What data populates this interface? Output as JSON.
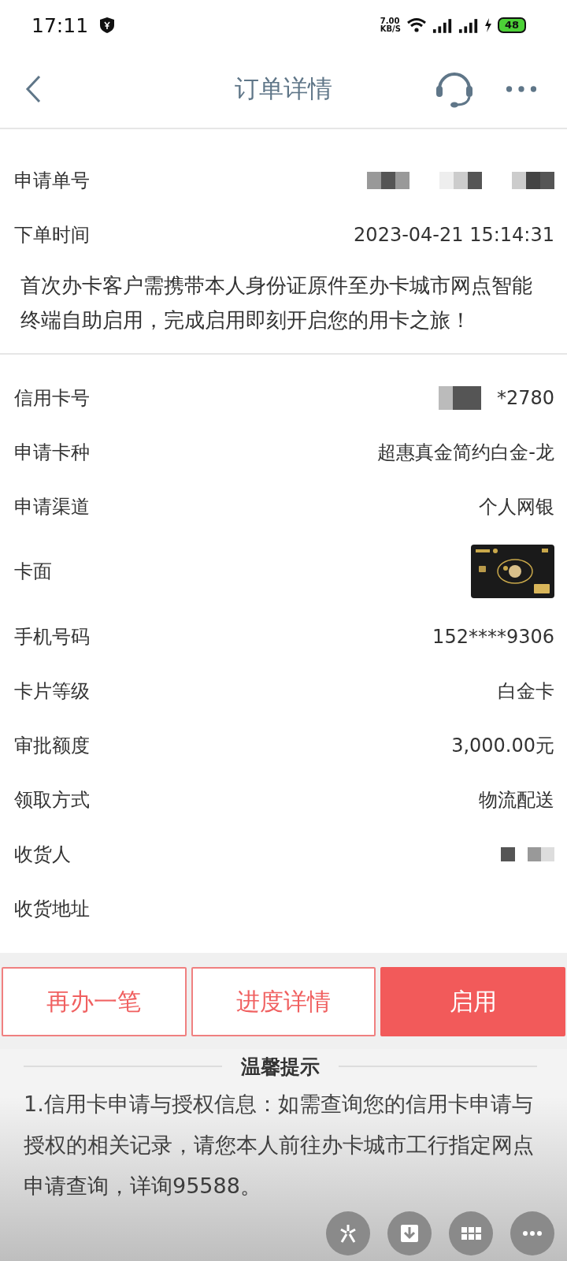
{
  "status_bar": {
    "time": "17:11",
    "speed": "7.00",
    "speed_unit": "KB/S",
    "battery": "48"
  },
  "header": {
    "title": "订单详情"
  },
  "top_rows": [
    {
      "label": "申请单号",
      "kind": "masked"
    },
    {
      "label": "下单时间",
      "kind": "text",
      "value": "2023-04-21 15:14:31"
    }
  ],
  "notice": "首次办卡客户需携带本人身份证原件至办卡城市网点智能终端自助启用，完成启用即刻开启您的用卡之旅！",
  "rows": [
    {
      "label": "信用卡号",
      "kind": "masked_text",
      "value": "*2780"
    },
    {
      "label": "申请卡种",
      "kind": "text",
      "value": "超惠真金简约白金-龙"
    },
    {
      "label": "申请渠道",
      "kind": "text",
      "value": "个人网银"
    },
    {
      "label": "卡面",
      "kind": "card"
    },
    {
      "label": "手机号码",
      "kind": "text",
      "value": "152****9306"
    },
    {
      "label": "卡片等级",
      "kind": "text",
      "value": "白金卡"
    },
    {
      "label": "审批额度",
      "kind": "text",
      "value": "3,000.00元"
    },
    {
      "label": "领取方式",
      "kind": "text",
      "value": "物流配送"
    },
    {
      "label": "收货人",
      "kind": "masked_small"
    },
    {
      "label": "收货地址",
      "kind": "empty"
    }
  ],
  "buttons": [
    {
      "label": "再办一笔",
      "kind": "outline"
    },
    {
      "label": "进度详情",
      "kind": "outline"
    },
    {
      "label": "启用",
      "kind": "filled"
    }
  ],
  "tips": {
    "title": "温馨提示",
    "text": "1.信用卡申请与授权信息：如需查询您的信用卡申请与授权的相关记录，请您本人前往办卡城市工行指定网点申请查询，详询95588。"
  }
}
